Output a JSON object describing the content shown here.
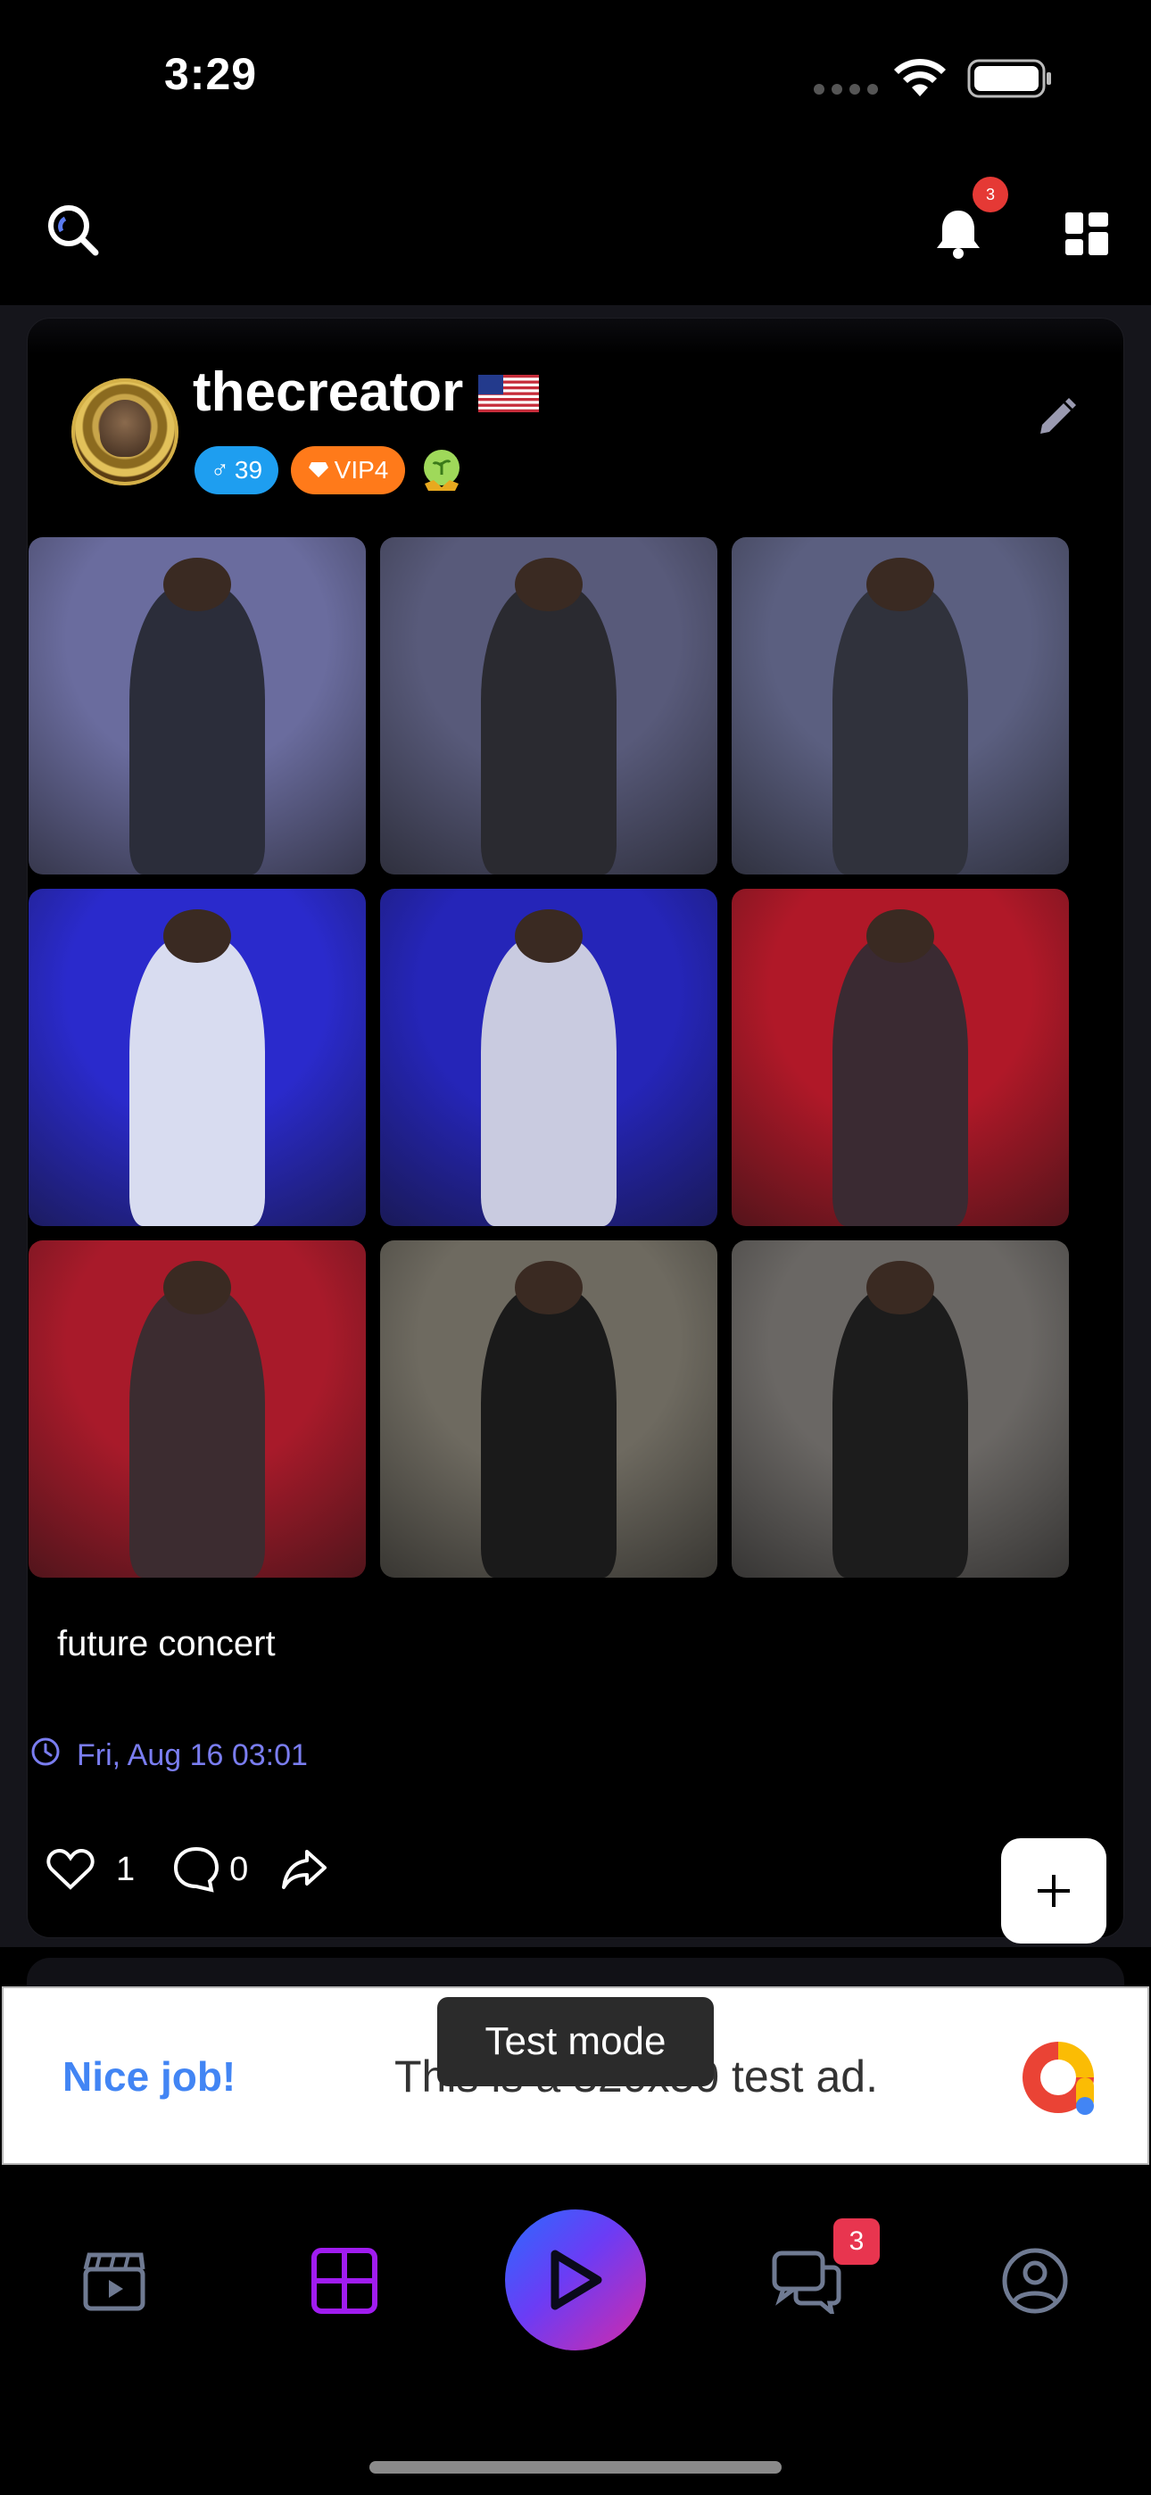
{
  "status_bar": {
    "time": "3:29"
  },
  "top_bar": {
    "notification_count": "3"
  },
  "post": {
    "username": "thecreator",
    "flag": "us-flag-icon",
    "gender_age": "39",
    "gender_symbol": "♂",
    "vip_label": "VIP4",
    "caption": "future concert",
    "timestamp": "Fri, Aug 16 03:01",
    "likes": "1",
    "comments": "0",
    "photos": [
      {
        "name": "concert-photo-1",
        "bg": "#6a6c9e",
        "fig": "#2b2d3a"
      },
      {
        "name": "concert-photo-2",
        "bg": "#585a7a",
        "fig": "#2a2a30"
      },
      {
        "name": "concert-photo-3",
        "bg": "#5b5f80",
        "fig": "#30323c"
      },
      {
        "name": "concert-photo-4",
        "bg": "#2a2acc",
        "fig": "#d8dcf0"
      },
      {
        "name": "concert-photo-5",
        "bg": "#2525b8",
        "fig": "#c9cbe0"
      },
      {
        "name": "concert-photo-6",
        "bg": "#b01828",
        "fig": "#3a2a32"
      },
      {
        "name": "concert-photo-7",
        "bg": "#a81a2a",
        "fig": "#3c2c30"
      },
      {
        "name": "concert-photo-8",
        "bg": "#6e6a60",
        "fig": "#1a1a1a"
      },
      {
        "name": "concert-photo-9",
        "bg": "#6a6764",
        "fig": "#1c1c1c"
      }
    ]
  },
  "ad": {
    "left_text": "Nice job!",
    "body_text": "This is a 320x50 test ad.",
    "toast": "Test mode"
  },
  "tab_bar": {
    "messages_badge": "3"
  },
  "colors": {
    "accent_purple": "#a01cf0",
    "timestamp_blue": "#7a7df0",
    "age_chip": "#1e9ef0",
    "vip_chip": "#ff7a1a"
  }
}
